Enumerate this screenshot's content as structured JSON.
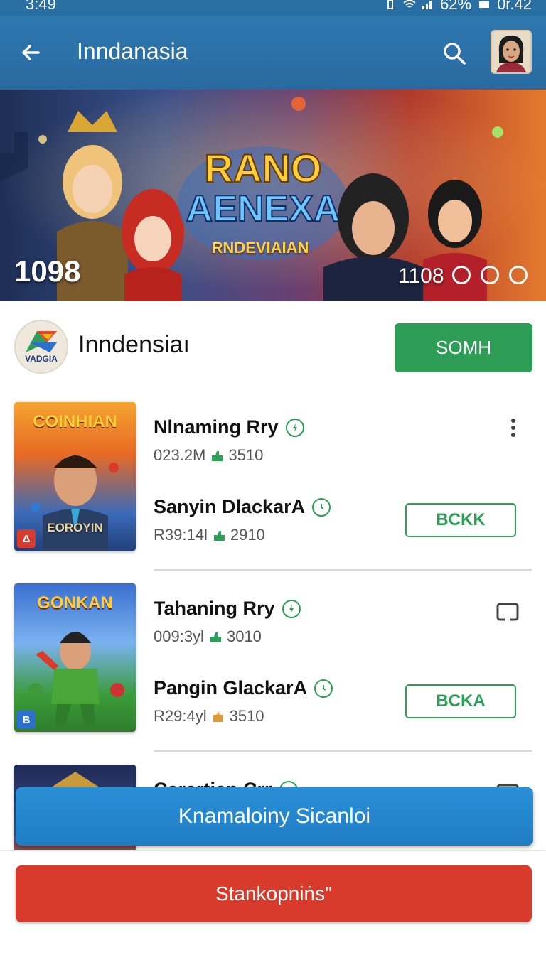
{
  "status_bar": {
    "time": "3:49",
    "battery": "62%",
    "clock_right": "0r.42"
  },
  "app_bar": {
    "title": "Inndanasia",
    "back_icon": "arrow-left-icon",
    "search_icon": "search-icon"
  },
  "hero": {
    "title": "RANO AENEXA",
    "subtitle": "RNDEVIAIAN",
    "count_left": "1098",
    "count_right": "1108"
  },
  "developer": {
    "logo_text": "VADGIA",
    "name": "Inndensiaı",
    "button_label": "SOMH"
  },
  "games": [
    {
      "thumb_title": "COINHIAN",
      "thumb_caption": "EOROYIN",
      "thumb_badge": "Δ",
      "name": "Nlnaming Rry",
      "stats": "023.2M",
      "stat_count": "3510",
      "sub_name": "Sanyin DlackarA",
      "sub_stats": "R39:14l",
      "sub_count": "2910",
      "button_label": "BCKK",
      "action_icon": "more-vertical-icon"
    },
    {
      "thumb_title": "GONKAN",
      "thumb_caption": "",
      "thumb_badge": "B",
      "name": "Tahaning Rry",
      "stats": "009:3yl",
      "stat_count": "3010",
      "sub_name": "Pangin GlackarA",
      "sub_stats": "R29:4yl",
      "sub_count": "3510",
      "button_label": "BCKA",
      "action_icon": "cast-icon"
    },
    {
      "name": "Carartian Crr"
    }
  ],
  "floating_button": "Knamaloiny Sicanloi",
  "primary_button": "Stankopniṅs\"",
  "colors": {
    "app_bar": "#2f78b0",
    "green": "#2e9d55",
    "blue_button": "#2488d0",
    "red_button": "#d83a2b"
  }
}
